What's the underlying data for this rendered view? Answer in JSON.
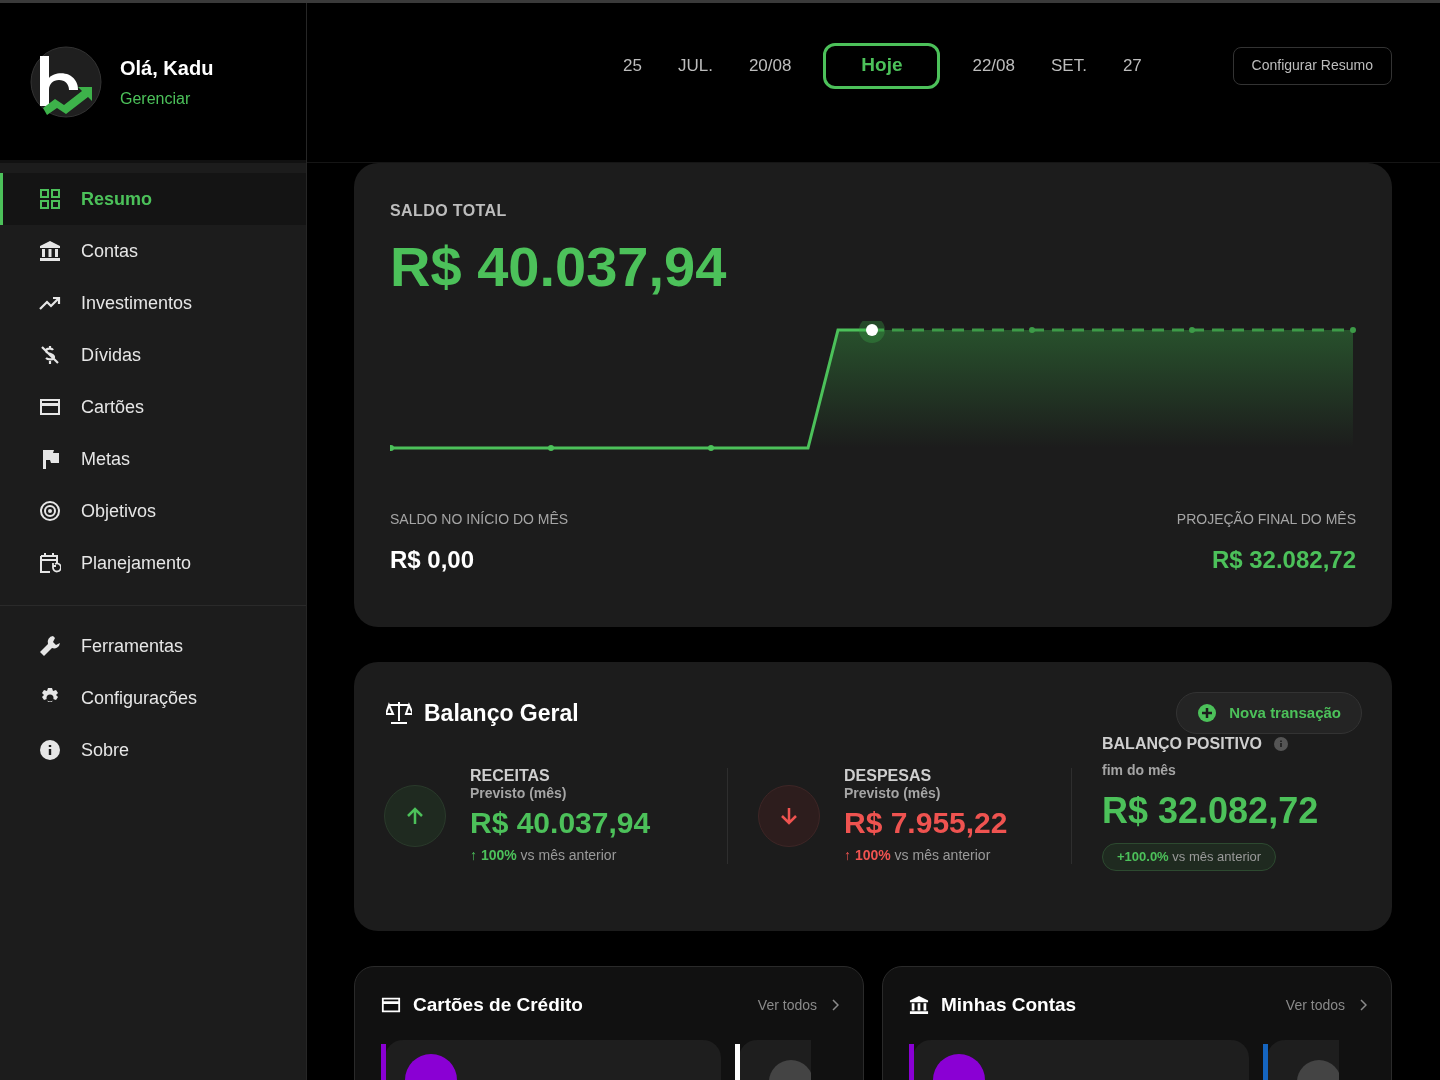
{
  "user": {
    "greeting": "Olá, Kadu",
    "action": "Gerenciar"
  },
  "nav": {
    "items": [
      {
        "label": "Resumo",
        "kind": "grid",
        "selected": true
      },
      {
        "label": "Contas",
        "kind": "bank",
        "selected": false
      },
      {
        "label": "Investimentos",
        "kind": "trend",
        "selected": false
      },
      {
        "label": "Dívidas",
        "kind": "nodollar",
        "selected": false
      },
      {
        "label": "Cartões",
        "kind": "card",
        "selected": false
      },
      {
        "label": "Metas",
        "kind": "flag",
        "selected": false
      },
      {
        "label": "Objetivos",
        "kind": "target",
        "selected": false
      },
      {
        "label": "Planejamento",
        "kind": "calendar",
        "selected": false
      }
    ],
    "secondary_items": [
      {
        "label": "Ferramentas",
        "kind": "wrench",
        "selected": false
      },
      {
        "label": "Configurações",
        "kind": "gear",
        "selected": false
      },
      {
        "label": "Sobre",
        "kind": "info",
        "selected": false
      }
    ]
  },
  "date_tabs": [
    {
      "label": "25",
      "selected": false
    },
    {
      "label": "JUL.",
      "selected": false
    },
    {
      "label": "20/08",
      "selected": false
    },
    {
      "label": "Hoje",
      "selected": true
    },
    {
      "label": "22/08",
      "selected": false
    },
    {
      "label": "SET.",
      "selected": false
    },
    {
      "label": "27",
      "selected": false
    }
  ],
  "configure_button": "Configurar Resumo",
  "balance": {
    "title": "SALDO TOTAL",
    "value": "R$ 40.037,94",
    "start": {
      "label": "SALDO NO INÍCIO DO MÊS",
      "value": "R$ 0,00"
    },
    "projection": {
      "label": "PROJEÇÃO FINAL DO MÊS",
      "value": "R$ 32.082,72"
    }
  },
  "overview": {
    "title": "Balanço Geral",
    "button": "Nova transação",
    "columns": [
      {
        "kind": "income",
        "title": "RECEITAS",
        "subtitle": "Previsto (mês)",
        "value": "R$ 40.037,94",
        "change_arrow": "↑",
        "change": "100%",
        "comparison": "vs mês anterior"
      },
      {
        "kind": "expense",
        "title": "DESPESAS",
        "subtitle": "Previsto (mês)",
        "value": "R$ 7.955,22",
        "change_arrow": "↑",
        "change": "100%",
        "comparison": "vs mês anterior"
      }
    ],
    "result": {
      "title": "BALANÇO POSITIVO",
      "subtitle": "fim do mês",
      "value": "R$ 32.082,72",
      "change": "+100.0%",
      "comparison": "vs mês anterior"
    }
  },
  "panels": [
    {
      "kind": "cards",
      "title": "Cartões de Crédito",
      "link": "Ver todos"
    },
    {
      "kind": "accounts",
      "title": "Minhas Contas",
      "link": "Ver todos"
    }
  ]
}
